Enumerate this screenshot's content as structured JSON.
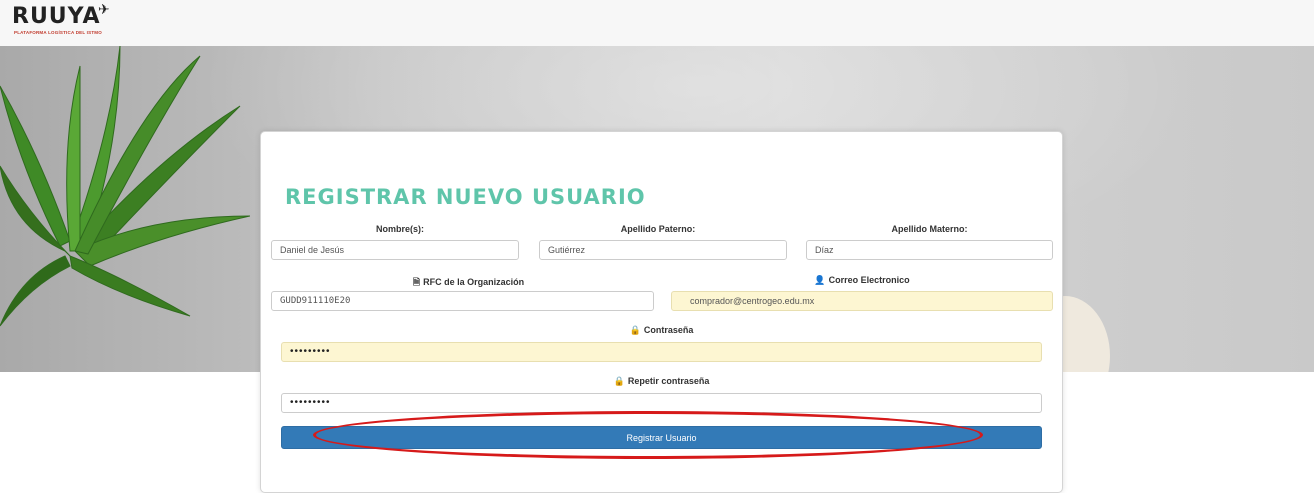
{
  "logo": {
    "name": "RUUYA",
    "plane": "✈",
    "tagline": "PLATAFORMA LOGÍSTICA DEL ISTMO"
  },
  "form": {
    "title": "REGISTRAR NUEVO USUARIO",
    "nombre": {
      "label": "Nombre(s):",
      "value": "Daniel de Jesús"
    },
    "apellido_paterno": {
      "label": "Apellido Paterno:",
      "value": "Gutiérrez"
    },
    "apellido_materno": {
      "label": "Apellido Materno:",
      "value": "Díaz"
    },
    "rfc": {
      "label": "RFC de la Organización",
      "icon": "document-icon",
      "value": "GUDD911110E20"
    },
    "correo": {
      "label": "Correo Electronico",
      "icon": "user-icon",
      "value": "comprador@centrogeo.edu.mx"
    },
    "contrasena": {
      "label": "Contraseña",
      "icon": "lock-icon",
      "value": "•••••••••"
    },
    "repetir_contrasena": {
      "label": "Repetir contraseña",
      "icon": "lock-icon",
      "value": "•••••••••"
    },
    "submit_label": "Registrar Usuario"
  },
  "colors": {
    "title": "#5fc5aa",
    "button": "#337ab7",
    "autofill": "#fdf6d2",
    "highlight": "#d61a1a"
  }
}
